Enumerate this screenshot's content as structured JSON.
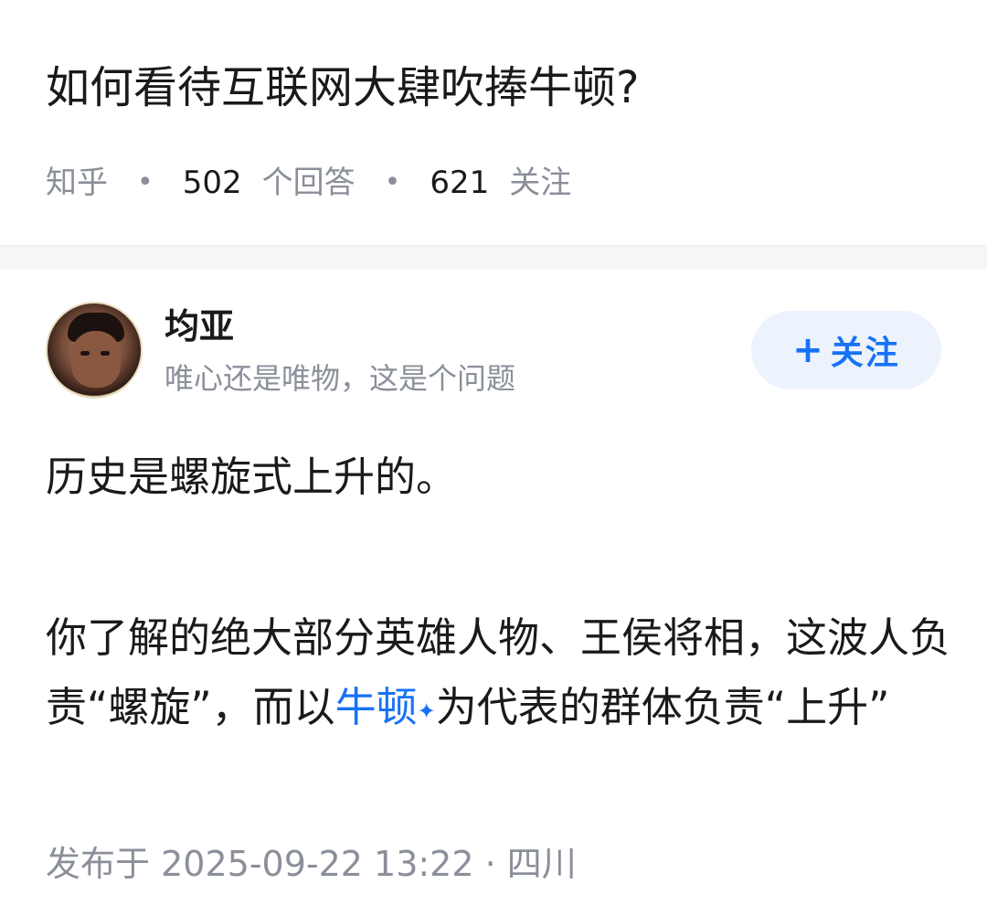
{
  "question": {
    "title": "如何看待互联网大肆吹捧牛顿?",
    "source": "知乎",
    "answer_count": "502",
    "answer_label": "个回答",
    "follower_count": "621",
    "follower_label": "关注"
  },
  "answer": {
    "author_name": "均亚",
    "author_bio": "唯心还是唯物，这是个问题",
    "follow_label": "关注",
    "follow_icon": "plus-icon",
    "paragraph1": "历史是螺旋式上升的。",
    "paragraph2_before_link": "你了解的绝大部分英雄人物、王侯将相，这波人负责“螺旋”，而以",
    "paragraph2_link": "牛顿",
    "paragraph2_after_link": "为代表的群体负责“上升”",
    "link_icon": "sparkle-icon",
    "publish_prefix": "发布于",
    "publish_datetime": "2025-09-22  13:22",
    "publish_location": "四川"
  },
  "colors": {
    "accent": "#1772f6",
    "muted": "#8a8f99",
    "follow_bg": "#ecf3fd"
  }
}
